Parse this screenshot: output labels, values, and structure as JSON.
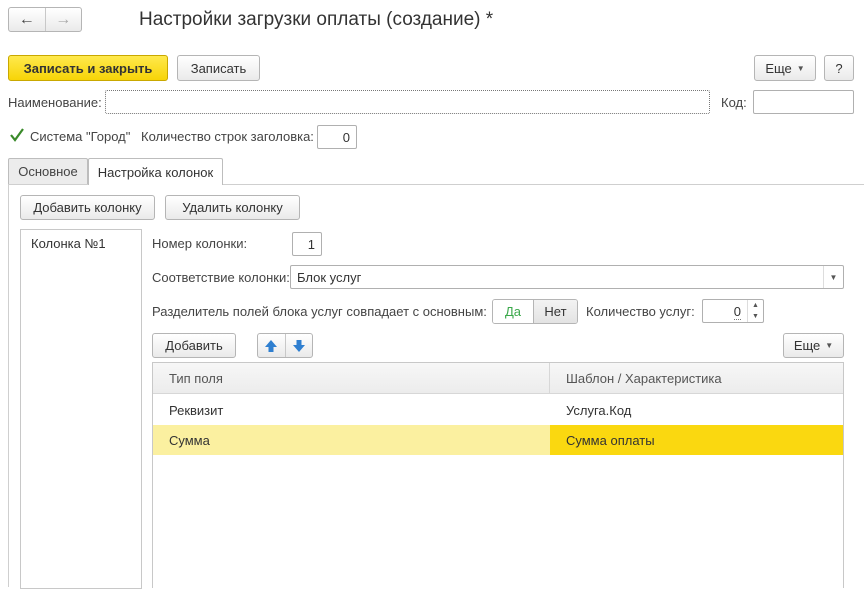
{
  "window": {
    "title": "Настройки загрузки оплаты (создание) *"
  },
  "toolbar": {
    "save_close_label": "Записать и закрыть",
    "save_label": "Записать",
    "more_label": "Еще",
    "help_label": "?"
  },
  "form": {
    "name_label": "Наименование:",
    "name_value": "",
    "code_label": "Код:",
    "code_value": "",
    "system_checkbox_label": "Система \"Город\"",
    "system_checked": true,
    "header_rows_label": "Количество строк заголовка:",
    "header_rows_value": "0"
  },
  "tabs": [
    {
      "label": "Основное",
      "active": false
    },
    {
      "label": "Настройка колонок",
      "active": true
    }
  ],
  "columns_panel": {
    "add_column_label": "Добавить колонку",
    "delete_column_label": "Удалить колонку",
    "list": [
      "Колонка №1"
    ]
  },
  "column_settings": {
    "number_label": "Номер колонки:",
    "number_value": "1",
    "match_label": "Соответствие колонки:",
    "match_value": "Блок услуг",
    "separator_label": "Разделитель полей блока услуг совпадает с основным:",
    "yes_label": "Да",
    "no_label": "Нет",
    "services_count_label": "Количество услуг:",
    "services_count_value": "0",
    "add_label": "Добавить",
    "more_label": "Еще"
  },
  "table": {
    "headers": [
      "Тип поля",
      "Шаблон / Характеристика"
    ],
    "rows": [
      {
        "type": "Реквизит",
        "template": "Услуга.Код",
        "selected": false
      },
      {
        "type": "Сумма",
        "template": "Сумма оплаты",
        "selected": true
      }
    ]
  },
  "colors": {
    "accent_yellow": "#f7d407",
    "selected_row": "#fbf0a0",
    "selected_cell": "#fad810",
    "check_green": "#3a8a2a",
    "arrow_blue": "#2f7fd0",
    "yes_green": "#3aa84a"
  }
}
